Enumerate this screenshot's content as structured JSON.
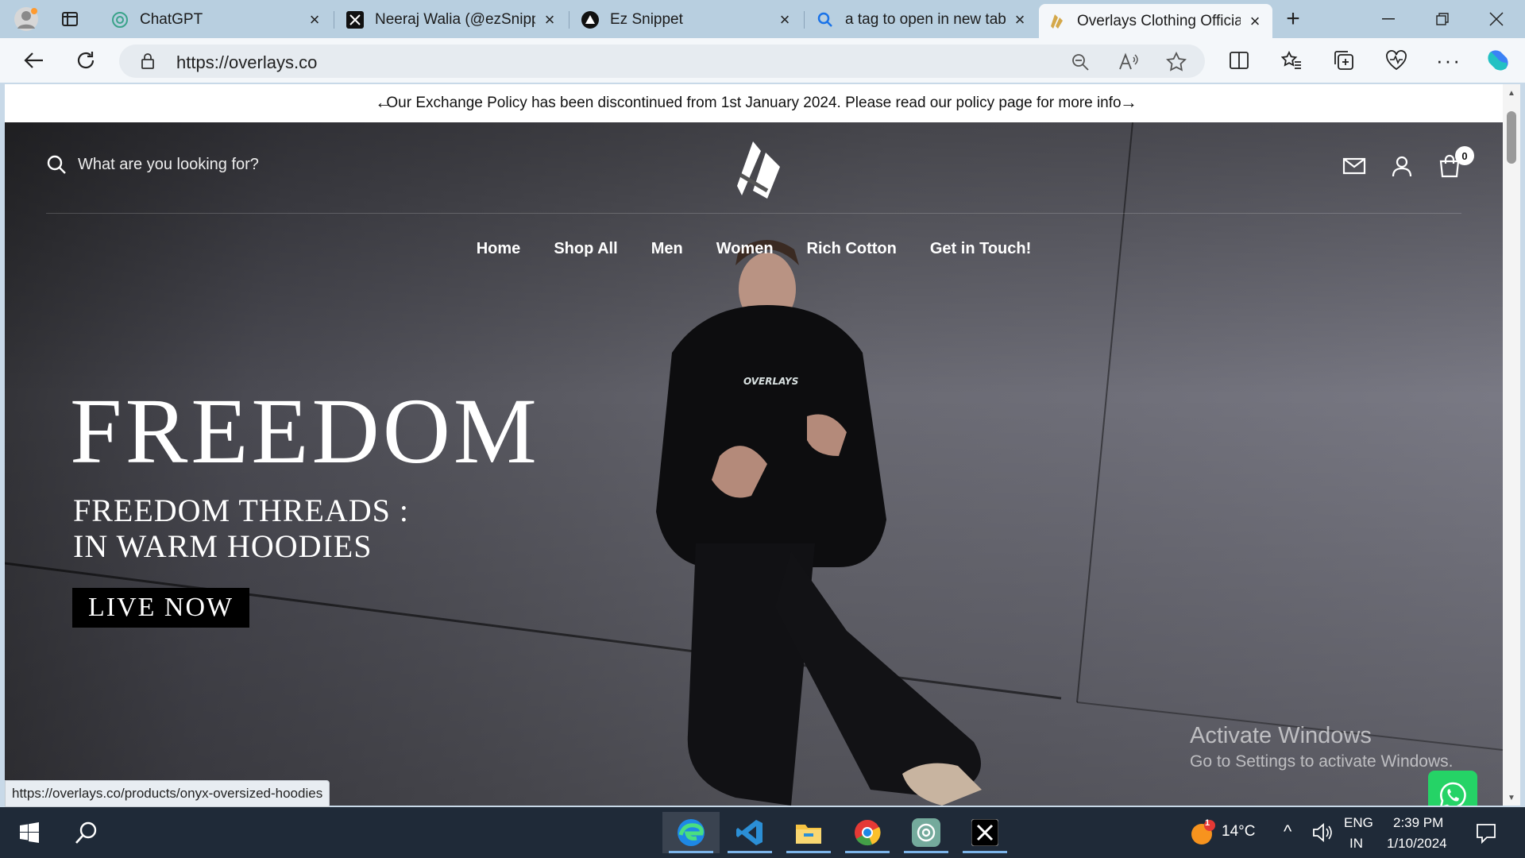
{
  "browser": {
    "tabs": [
      {
        "title": "ChatGPT",
        "icon": "chatgpt-icon"
      },
      {
        "title": "Neeraj Walia (@ezSnippet",
        "icon": "x-icon"
      },
      {
        "title": "Ez Snippet",
        "icon": "ezsnippet-icon"
      },
      {
        "title": "a tag to open in new tab",
        "icon": "search-icon"
      },
      {
        "title": "Overlays Clothing Officia",
        "icon": "overlays-icon",
        "active": true
      }
    ],
    "url": "https://overlays.co",
    "status_url": "https://overlays.co/products/onyx-oversized-hoodies"
  },
  "announcement": {
    "text": "Our Exchange Policy has been discontinued from 1st January 2024. Please read our policy page for more info"
  },
  "header": {
    "search_placeholder": "What are you looking for?",
    "cart_count": "0"
  },
  "menu": [
    "Home",
    "Shop All",
    "Men",
    "Women",
    "Rich Cotton",
    "Get in Touch!"
  ],
  "hero": {
    "headline": "FREEDOM",
    "sub_line1": "FREEDOM THREADS :",
    "sub_line2": "IN WARM HOODIES",
    "cta": "LIVE NOW",
    "hoodie_text": "OVERLAYS"
  },
  "watermark": {
    "line1": "Activate Windows",
    "line2": "Go to Settings to activate Windows."
  },
  "taskbar": {
    "weather": "14°C",
    "lang1": "ENG",
    "lang2": "IN",
    "time": "2:39 PM",
    "date": "1/10/2024",
    "weather_badge": "1"
  },
  "colors": {
    "accent": "#25d366",
    "tab_active": "#f4f7fa",
    "taskbar": "#1f2a38"
  }
}
